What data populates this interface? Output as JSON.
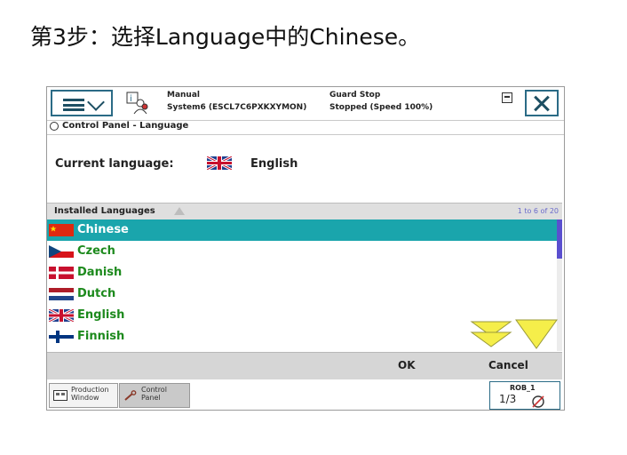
{
  "slide": {
    "title": "第3步：选择Language中的Chinese。"
  },
  "status": {
    "mode": "Manual",
    "system": "System6 (ESCL7C6PXKXYMON)",
    "safety": "Guard Stop",
    "state": "Stopped (Speed 100%)"
  },
  "breadcrumb": "Control Panel - Language",
  "current": {
    "label": "Current language:",
    "value": "English"
  },
  "list": {
    "header": "Installed Languages",
    "count": "1 to 6 of 20",
    "items": [
      {
        "label": "Chinese",
        "flag": "flag-china",
        "selected": true
      },
      {
        "label": "Czech",
        "flag": "flag-czech"
      },
      {
        "label": "Danish",
        "flag": "flag-denmark"
      },
      {
        "label": "Dutch",
        "flag": "flag-netherlands"
      },
      {
        "label": "English",
        "flag": "flag-uk"
      },
      {
        "label": "Finnish",
        "flag": "flag-finland"
      }
    ]
  },
  "actions": {
    "ok": "OK",
    "cancel": "Cancel"
  },
  "taskbar": {
    "tasks": [
      {
        "line1": "Production",
        "line2": "Window"
      },
      {
        "line1": "Control",
        "line2": "Panel"
      }
    ],
    "robot": {
      "label": "ROB_1",
      "fraction": "1/3"
    }
  },
  "colors": {
    "selected_row": "#1aa5ac",
    "list_text": "#1d8a1d",
    "frame_accent": "#2b6b86",
    "scroll_arrow": "#f5ee4a"
  }
}
